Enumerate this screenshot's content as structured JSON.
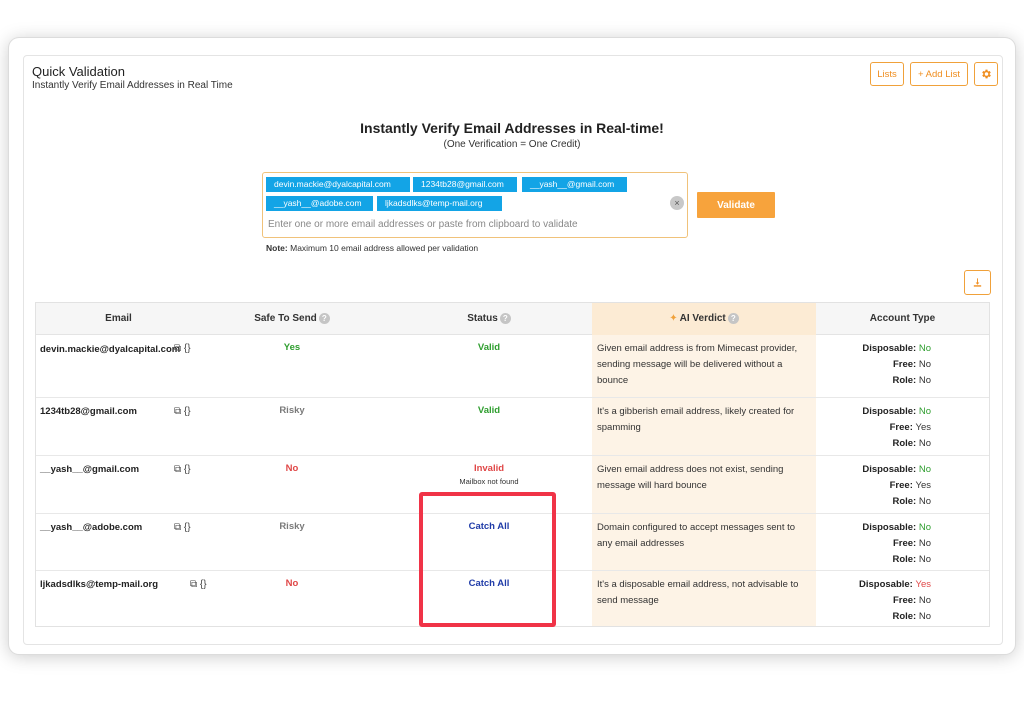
{
  "header": {
    "title": "Quick Validation",
    "subtitle": "Instantly Verify Email Addresses in Real Time"
  },
  "toolbar": {
    "lists_label": "Lists",
    "add_list_label": "+ Add List",
    "settings_icon": "gear-icon"
  },
  "hero": {
    "title": "Instantly Verify Email Addresses in Real-time!",
    "subtitle": "(One Verification = One Credit)"
  },
  "input": {
    "chips": [
      "devin.mackie@dyalcapital.com",
      "1234tb28@gmail.com",
      "__yash__@gmail.com",
      "__yash__@adobe.com",
      "ljkadsdlks@temp-mail.org"
    ],
    "placeholder": "Enter one or more email addresses or paste from clipboard to validate",
    "clear_symbol": "×"
  },
  "validate_label": "Validate",
  "note": {
    "label": "Note:",
    "text": "Maximum 10 email address allowed per validation"
  },
  "download_icon": "download-icon",
  "table": {
    "headers": {
      "email": "Email",
      "safe": "Safe To Send",
      "status": "Status",
      "verdict": "AI Verdict",
      "account": "Account Type"
    },
    "account_labels": {
      "disposable": "Disposable:",
      "free": "Free:",
      "role": "Role:"
    },
    "rows": [
      {
        "email": "devin.mackie@dyalcapital.com",
        "safe": "Yes",
        "status": "Valid",
        "status_sub": "",
        "verdict": "Given email address is from Mimecast provider, sending message will be delivered without a bounce",
        "disposable": "No",
        "free": "No",
        "role": "No"
      },
      {
        "email": "1234tb28@gmail.com",
        "safe": "Risky",
        "status": "Valid",
        "status_sub": "",
        "verdict": "It's a gibberish email address, likely created for spamming",
        "disposable": "No",
        "free": "Yes",
        "role": "No"
      },
      {
        "email": "__yash__@gmail.com",
        "safe": "No",
        "status": "Invalid",
        "status_sub": "Mailbox not found",
        "verdict": "Given email address does not exist, sending message will hard bounce",
        "disposable": "No",
        "free": "Yes",
        "role": "No"
      },
      {
        "email": "__yash__@adobe.com",
        "safe": "Risky",
        "status": "Catch All",
        "status_sub": "",
        "verdict": "Domain configured to accept messages sent to any email addresses",
        "disposable": "No",
        "free": "No",
        "role": "No"
      },
      {
        "email": "ljkadsdlks@temp-mail.org",
        "safe": "No",
        "status": "Catch All",
        "status_sub": "",
        "verdict": "It's a disposable email address, not advisable to send message",
        "disposable": "Yes",
        "free": "No",
        "role": "No"
      }
    ]
  },
  "colors": {
    "accent": "#f7a33c",
    "chip": "#13a4e6",
    "valid": "#2f9e2f",
    "invalid": "#e04747",
    "catch_all": "#1f3ba8",
    "highlight": "#f03347"
  }
}
